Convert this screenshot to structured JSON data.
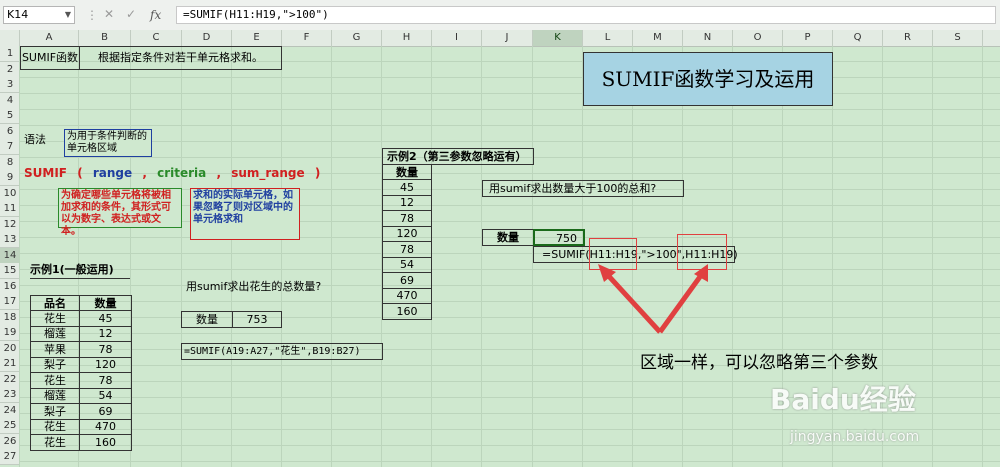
{
  "formula_bar": {
    "name_box": "K14",
    "formula": "=SUMIF(H11:H19,\">100\")",
    "fx_label": "fx"
  },
  "columns": [
    "A",
    "B",
    "C",
    "D",
    "E",
    "F",
    "G",
    "H",
    "I",
    "J",
    "K",
    "L",
    "M",
    "N",
    "O",
    "P",
    "Q",
    "R",
    "S"
  ],
  "selected_column": "K",
  "rows": [
    "1",
    "2",
    "3",
    "4",
    "5",
    "6",
    "7",
    "8",
    "9",
    "10",
    "11",
    "12",
    "13",
    "14",
    "15",
    "16",
    "17",
    "18",
    "19",
    "20",
    "21",
    "22",
    "23",
    "24",
    "25",
    "26",
    "27"
  ],
  "selected_row": "14",
  "header_box": {
    "label": "SUMIF函数",
    "desc": "根据指定条件对若干单元格求和。"
  },
  "title_banner": "SUMIF函数学习及运用",
  "syntax": {
    "label": "语法",
    "fn": "SUMIF",
    "open": "(",
    "arg1": "range",
    "comma1": ",",
    "arg2": "criteria",
    "comma2": ",",
    "arg3": "sum_range",
    "close": ")",
    "note_range": "为用于条件判断的单元格区域",
    "note_criteria": "为确定哪些单元格将被相加求和的条件，其形式可以为数字、表达式或文本。",
    "note_sum_range": "求和的实际单元格，如果忽略了则对区域中的单元格求和"
  },
  "example1": {
    "title": "示例1(一般运用)",
    "headers": [
      "品名",
      "数量"
    ],
    "rows": [
      [
        "花生",
        "45"
      ],
      [
        "榴莲",
        "12"
      ],
      [
        "苹果",
        "78"
      ],
      [
        "梨子",
        "120"
      ],
      [
        "花生",
        "78"
      ],
      [
        "榴莲",
        "54"
      ],
      [
        "梨子",
        "69"
      ],
      [
        "花生",
        "470"
      ],
      [
        "花生",
        "160"
      ]
    ],
    "question": "用sumif求出花生的总数量?",
    "result_label": "数量",
    "result_value": "753",
    "formula": "=SUMIF(A19:A27,\"花生\",B19:B27)"
  },
  "example2": {
    "title": "示例2（第三参数忽略运有）",
    "header": "数量",
    "values": [
      "45",
      "12",
      "78",
      "120",
      "78",
      "54",
      "69",
      "470",
      "160"
    ],
    "question": "用sumif求出数量大于100的总和?",
    "result_label": "数量",
    "result_value": "750",
    "formula": "=SUMIF(H11:H19,\">100\",H11:H19)",
    "annotation": "区域一样，可以忽略第三个参数"
  },
  "watermark": {
    "brand": "Baidu经验",
    "url": "jingyan.baidu.com"
  },
  "colors": {
    "grid_bg": "#cfe8cf",
    "banner_bg": "#a6d3e3",
    "red": "#d02020",
    "blue": "#1f3fa0",
    "green": "#2a8a2a",
    "annotation_red": "#e04040"
  }
}
